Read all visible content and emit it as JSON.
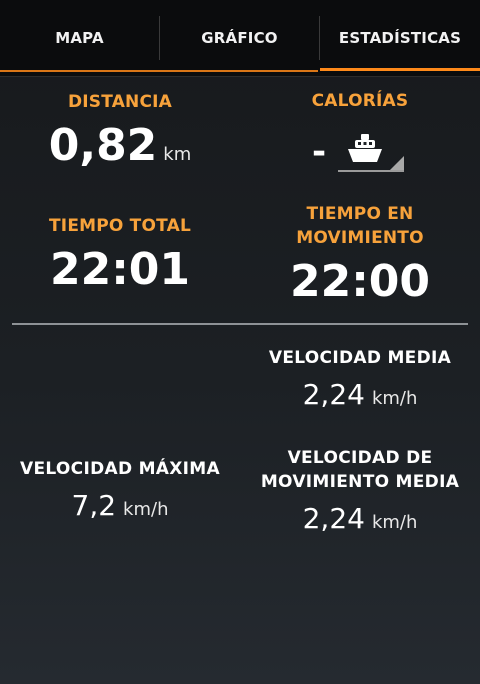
{
  "tabs": [
    {
      "label": "MAPA"
    },
    {
      "label": "GRÁFICO"
    },
    {
      "label": "ESTADÍSTICAS",
      "active": true
    }
  ],
  "stats": {
    "distance": {
      "label": "DISTANCIA",
      "value": "0,82",
      "unit": "km"
    },
    "calories": {
      "label": "CALORÍAS",
      "value": "-",
      "activity_icon": "boat-icon"
    },
    "total_time": {
      "label": "TIEMPO TOTAL",
      "value": "22:01"
    },
    "moving_time": {
      "label_line1": "TIEMPO EN",
      "label_line2": "MOVIMIENTO",
      "value": "22:00"
    },
    "avg_speed": {
      "label": "VELOCIDAD MEDIA",
      "value": "2,24",
      "unit": "km/h"
    },
    "max_speed": {
      "label": "VELOCIDAD MÁXIMA",
      "value": "7,2",
      "unit": "km/h"
    },
    "avg_moving_speed": {
      "label_line1": "VELOCIDAD DE",
      "label_line2": "MOVIMIENTO MEDIA",
      "value": "2,24",
      "unit": "km/h"
    }
  },
  "colors": {
    "accent": "#ff8a1a",
    "label": "#f7a23b",
    "background": "#1c2024",
    "tabbar": "#0b0c0d"
  }
}
